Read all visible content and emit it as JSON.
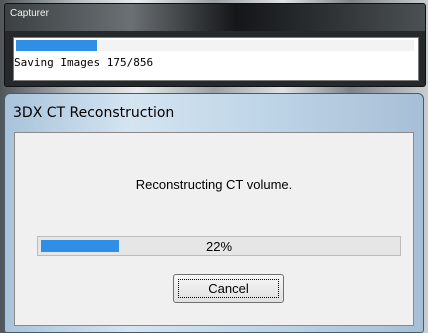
{
  "capturer": {
    "title": "Capturer",
    "status": "Saving Images 175/856",
    "progress": 0.2044,
    "accent_color": "#2f8fe6"
  },
  "reconstruction": {
    "title": "3DX CT Reconstruction",
    "message": "Reconstructing CT volume.",
    "progress": 0.22,
    "progress_text": "22%",
    "cancel_label": "Cancel",
    "accent_color": "#2f8fe6"
  }
}
